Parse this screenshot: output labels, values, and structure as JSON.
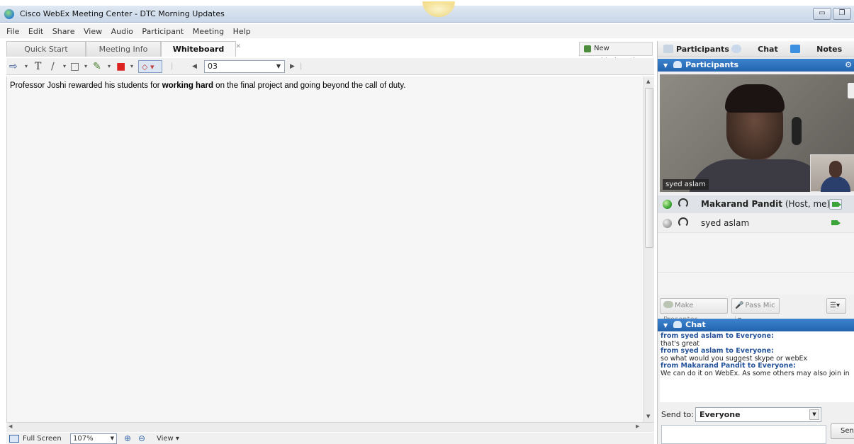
{
  "window": {
    "title": "Cisco WebEx Meeting Center - DTC Morning Updates"
  },
  "menu": [
    "File",
    "Edit",
    "Share",
    "View",
    "Audio",
    "Participant",
    "Meeting",
    "Help"
  ],
  "tabs": [
    {
      "label": "Quick Start"
    },
    {
      "label": "Meeting Info"
    },
    {
      "label": "Whiteboard",
      "active": true
    }
  ],
  "new_whiteboard_label": "New Whiteboard",
  "toolbar": {
    "page_value": "03",
    "text_tool_glyph": "T"
  },
  "whiteboard": {
    "text_before": "Professor Joshi rewarded his students for ",
    "text_bold": "working hard",
    "text_after": " on the final project and going beyond the call of duty."
  },
  "statusbar": {
    "fullscreen_label": "Full Screen",
    "zoom_value": "107%",
    "view_label": "View"
  },
  "right_panel": {
    "tabs": {
      "participants": "Participants",
      "chat": "Chat",
      "notes": "Notes"
    },
    "participants_header": "Participants",
    "video_name": "syed aslam",
    "participants": [
      {
        "name": "Makarand Pandit",
        "suffix": " (Host, me)",
        "status": "green"
      },
      {
        "name": "syed aslam",
        "suffix": "",
        "status": "gray"
      }
    ],
    "buttons": {
      "make_presenter": "Make Presenter",
      "pass_mic": "Pass Mic"
    },
    "chat_header": "Chat",
    "chat_messages": [
      {
        "from": "from syed aslam to Everyone:",
        "text": "that's great"
      },
      {
        "from": "from syed aslam to Everyone:",
        "text": "so what would you suggest skype or webEx"
      },
      {
        "from": "from Makarand Pandit to Everyone:",
        "text": "We can do it on WebEx. As some others may also join in"
      }
    ],
    "send_to_label": "Send to:",
    "send_to_value": "Everyone",
    "send_label": "Send"
  },
  "colors": {
    "section_blue": "#2d6fbf",
    "chat_from": "#24539a",
    "status_green": "#34a02c"
  }
}
